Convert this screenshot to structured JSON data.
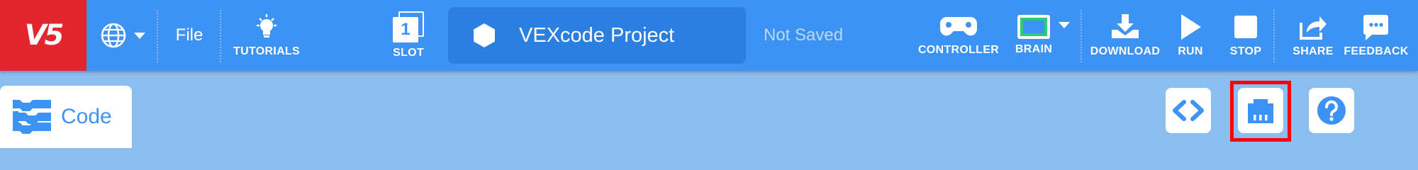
{
  "toolbar": {
    "logo_text": "V5",
    "file_label": "File",
    "tutorials_label": "TUTORIALS",
    "slot_number": "1",
    "slot_label": "SLOT",
    "project_title": "VEXcode Project",
    "save_status": "Not Saved",
    "controller_label": "CONTROLLER",
    "brain_label": "BRAIN",
    "download_label": "DOWNLOAD",
    "run_label": "RUN",
    "stop_label": "STOP",
    "share_label": "SHARE",
    "feedback_label": "FEEDBACK"
  },
  "workspace": {
    "code_tab_label": "Code",
    "right_buttons": [
      "code-view-icon",
      "devices-port-icon",
      "help-icon"
    ]
  },
  "icons": {
    "language": "globe-icon",
    "tutorials": "lightbulb-icon",
    "slot": "slot-icon",
    "project": "hexagon-icon",
    "controller": "gamepad-icon",
    "brain": "brain-screen-icon",
    "download": "download-icon",
    "run": "play-icon",
    "stop": "stop-icon",
    "share": "share-icon",
    "feedback": "chat-bubble-icon"
  },
  "colors": {
    "toolbar_bg": "#3c93f4",
    "logo_bg": "#e3262e",
    "workspace_bg": "#8bbdee",
    "project_box_bg": "#2b7fe0",
    "brain_screen": "#2ecc71",
    "highlight": "#ff0000"
  }
}
